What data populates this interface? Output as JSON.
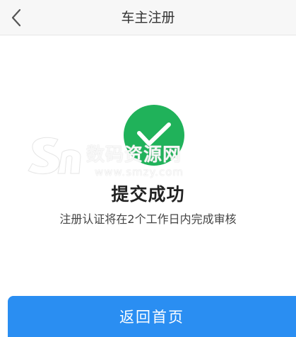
{
  "header": {
    "title": "车主注册",
    "back_icon": "chevron-left-icon"
  },
  "status": {
    "icon": "check-circle-icon",
    "icon_color": "#20b25a",
    "title": "提交成功",
    "description": "注册认证将在2个工作日内完成审核"
  },
  "watermark": {
    "logo_text": "数码资源网",
    "url_text": "www.smzy.com"
  },
  "footer": {
    "button_label": "返回首页",
    "button_color": "#2a8ef2"
  }
}
